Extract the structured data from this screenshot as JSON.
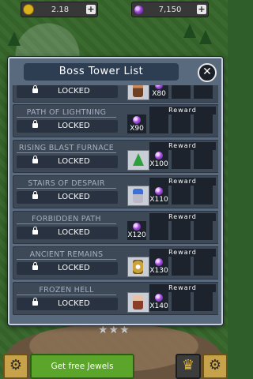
{
  "hud": {
    "gold_value": "2.18",
    "jewel_value": "7,150"
  },
  "modal": {
    "title": "Boss Tower List"
  },
  "reward_label": "Reward",
  "towers": [
    {
      "name": "",
      "status": "LOCKED",
      "boss": "brown-knight",
      "jewels": "X80",
      "show_header": false
    },
    {
      "name": "PATH OF LIGHTNING",
      "status": "LOCKED",
      "boss": "none",
      "jewels": "X90",
      "show_header": true
    },
    {
      "name": "RISING BLAST FURNACE",
      "status": "LOCKED",
      "boss": "green-tree",
      "jewels": "X100",
      "show_header": true
    },
    {
      "name": "STAIRS OF DESPAIR",
      "status": "LOCKED",
      "boss": "blue-hair-warrior",
      "jewels": "X110",
      "show_header": true
    },
    {
      "name": "FORBIDDEN PATH",
      "status": "LOCKED",
      "boss": "none",
      "jewels": "X120",
      "show_header": true
    },
    {
      "name": "ANCIENT REMAINS",
      "status": "LOCKED",
      "boss": "golden-ring",
      "jewels": "X130",
      "show_header": true
    },
    {
      "name": "FROZEN HELL",
      "status": "LOCKED",
      "boss": "brown-hair-girl",
      "jewels": "X140",
      "show_header": true
    }
  ],
  "bottom": {
    "free_jewels_label": "Get free Jewels"
  }
}
